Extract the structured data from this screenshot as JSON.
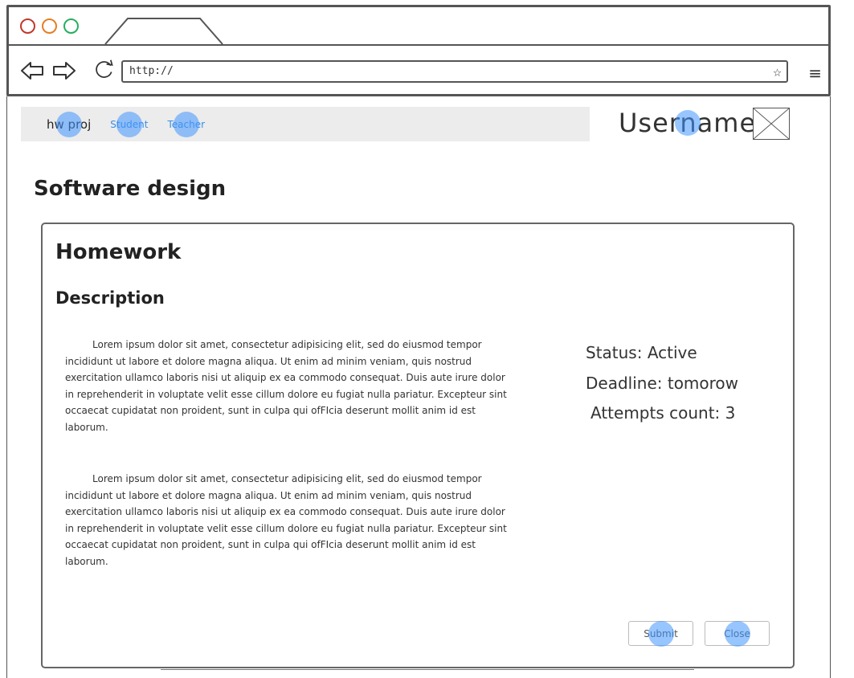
{
  "browser": {
    "url": "http://",
    "star_glyph": "☆",
    "menu_glyph": "≡"
  },
  "app_nav": {
    "brand": "hw proj",
    "links": [
      "Student",
      "Teacher"
    ]
  },
  "user": {
    "name": "Username"
  },
  "course": {
    "title": "Software design"
  },
  "homework": {
    "title": "Homework",
    "description_heading": "Description",
    "paragraphs": [
      "Lorem ipsum dolor sit amet, consectetur adipisicing elit, sed do eiusmod tempor incididunt ut labore et dolore magna aliqua. Ut enim ad minim veniam, quis nostrud exercitation ullamco laboris nisi ut aliquip ex ea commodo consequat. Duis aute irure dolor in reprehenderit in voluptate velit esse cillum dolore eu fugiat nulla pariatur. Excepteur sint occaecat cupidatat non proident, sunt in culpa qui ofFIcia deserunt mollit anim id est laborum.",
      "Lorem ipsum dolor sit amet, consectetur adipisicing elit, sed do eiusmod tempor incididunt ut labore et dolore magna aliqua. Ut enim ad minim veniam, quis nostrud exercitation ullamco laboris nisi ut aliquip ex ea commodo consequat. Duis aute irure dolor in reprehenderit in voluptate velit esse cillum dolore eu fugiat nulla pariatur. Excepteur sint occaecat cupidatat non proident, sunt in culpa qui ofFIcia deserunt mollit anim id est laborum."
    ],
    "status": "Status: Active",
    "deadline": "Deadline: tomorow",
    "attempts": "Attempts count: 3",
    "submit_label": "Submit",
    "close_label": "Close"
  },
  "colors": {
    "link": "#3a8ee6",
    "nav_bg": "#ececec",
    "click_hint": "#4296ff"
  }
}
